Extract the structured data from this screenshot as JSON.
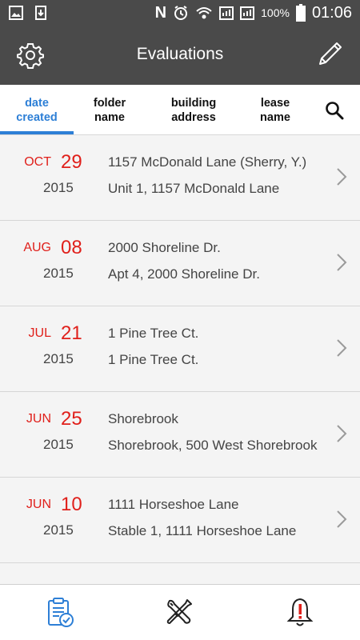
{
  "status_bar": {
    "battery_pct": "100%",
    "time": "01:06"
  },
  "header": {
    "title": "Evaluations"
  },
  "tabs": [
    {
      "label": "date\ncreated",
      "active": true
    },
    {
      "label": "folder\nname",
      "active": false
    },
    {
      "label": "building\naddress",
      "active": false
    },
    {
      "label": "lease\nname",
      "active": false
    }
  ],
  "evaluations": [
    {
      "month": "OCT",
      "day": "29",
      "year": "2015",
      "line1": "1157 McDonald Lane (Sherry, Y.)",
      "line2": "Unit 1, 1157 McDonald Lane"
    },
    {
      "month": "AUG",
      "day": "08",
      "year": "2015",
      "line1": "2000 Shoreline Dr.",
      "line2": "Apt 4, 2000 Shoreline Dr."
    },
    {
      "month": "JUL",
      "day": "21",
      "year": "2015",
      "line1": "1 Pine Tree Ct.",
      "line2": "1 Pine Tree Ct."
    },
    {
      "month": "JUN",
      "day": "25",
      "year": "2015",
      "line1": "Shorebrook",
      "line2": "Shorebrook, 500 West Shorebrook"
    },
    {
      "month": "JUN",
      "day": "10",
      "year": "2015",
      "line1": "1111 Horseshoe Lane",
      "line2": "Stable 1, 1111 Horseshoe Lane"
    }
  ],
  "colors": {
    "accent": "#2d7fd6",
    "date_red": "#e0201b",
    "header_bg": "#4a4a4a",
    "alert_red": "#e0201b"
  },
  "icons": {
    "header_left": "gear-icon",
    "header_right": "pencil-icon",
    "sort_search": "search-icon",
    "nav": [
      "clipboard-check-icon",
      "tools-icon",
      "alert-bell-icon"
    ]
  }
}
